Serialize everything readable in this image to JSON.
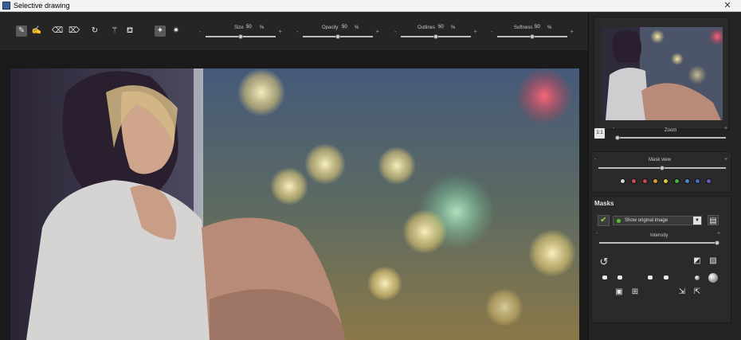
{
  "window": {
    "title": "Selective drawing",
    "close_symbol": "✕"
  },
  "toolbar": {
    "tools": [
      {
        "name": "brush-tool",
        "icon": "brush-icon",
        "glyph": "✎",
        "active": true
      },
      {
        "name": "brush-hand-tool",
        "icon": "hand-brush-icon",
        "glyph": "✍",
        "active": false
      },
      {
        "name": "eraser-tool",
        "icon": "eraser-icon",
        "glyph": "⌫",
        "active": false
      },
      {
        "name": "eraser-alt-tool",
        "icon": "eraser-fill-icon",
        "glyph": "⌦",
        "active": false
      },
      {
        "name": "lasso-tool",
        "icon": "lasso-icon",
        "glyph": "↻",
        "active": false
      },
      {
        "name": "wand-tool",
        "icon": "wand-icon",
        "glyph": "⚚",
        "active": false
      },
      {
        "name": "fill-tool",
        "icon": "bucket-icon",
        "glyph": "⛾",
        "active": false
      },
      {
        "name": "magic-select-tool",
        "icon": "magic-select-icon",
        "glyph": "✦",
        "active": true
      },
      {
        "name": "sparkle-tool",
        "icon": "sparkle-icon",
        "glyph": "✷",
        "active": false
      }
    ],
    "sliders": [
      {
        "label": "Size",
        "value": "50",
        "unit": "%",
        "level": 0.5
      },
      {
        "label": "Opacity",
        "value": "50",
        "unit": "%",
        "level": 0.5
      },
      {
        "label": "Outlines",
        "value": "50",
        "unit": "%",
        "level": 0.5
      },
      {
        "label": "Softness",
        "value": "50",
        "unit": "%",
        "level": 0.5
      }
    ],
    "minus": "-",
    "plus": "+"
  },
  "navigator": {
    "zoom_button": "1:1",
    "zoom_label": "Zoom",
    "zoom_level": 0.0,
    "minus": "-",
    "plus": "+"
  },
  "mask_view": {
    "label": "Mask view",
    "level": 0.5,
    "minus": "-",
    "plus": "+",
    "colors": [
      "#d6d6d6",
      "#d24a55",
      "#c24a4e",
      "#d99a3a",
      "#d8c93c",
      "#45b046",
      "#4a86c9",
      "#4a6ac9",
      "#6a5fb7"
    ]
  },
  "masks": {
    "title": "Masks",
    "check_symbol": "✔",
    "mask_select": "Show original image",
    "dropdown_symbol": "▼",
    "intensity_label": "Intensity",
    "intensity_level": 1.0,
    "minus": "-",
    "plus": "+",
    "undo_symbol": "↺",
    "invert_symbol": "◩",
    "image_symbol": "▨"
  }
}
